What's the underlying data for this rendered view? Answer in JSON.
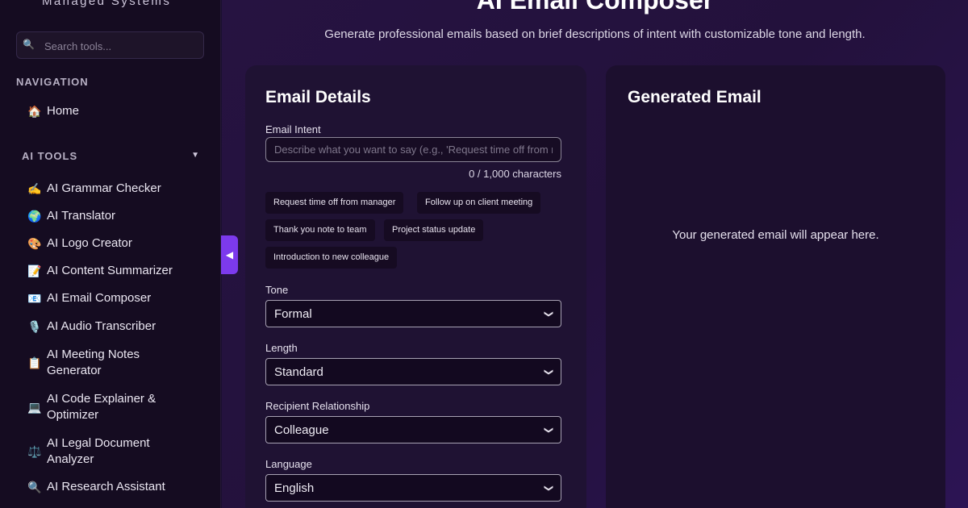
{
  "sidebar": {
    "brand": "Managed Systems",
    "search_placeholder": "Search tools...",
    "navigation_label": "NAVIGATION",
    "home": {
      "icon": "🏠",
      "label": "Home"
    },
    "ai_tools_label": "AI TOOLS",
    "ai_tools_caret": "▼",
    "tools": [
      {
        "icon": "✍️",
        "label": "AI Grammar Checker"
      },
      {
        "icon": "🌍",
        "label": "AI Translator"
      },
      {
        "icon": "🎨",
        "label": "AI Logo Creator"
      },
      {
        "icon": "📝",
        "label": "AI Content Summarizer"
      },
      {
        "icon": "📧",
        "label": "AI Email Composer"
      },
      {
        "icon": "🎙️",
        "label": "AI Audio Transcriber"
      },
      {
        "icon": "📋",
        "label": "AI Meeting Notes Generator"
      },
      {
        "icon": "💻",
        "label": "AI Code Explainer & Optimizer"
      },
      {
        "icon": "⚖️",
        "label": "AI Legal Document Analyzer"
      },
      {
        "icon": "🔍",
        "label": "AI Research Assistant"
      }
    ]
  },
  "collapse_icon": "◀",
  "header": {
    "title": "AI Email Composer",
    "subtitle": "Generate professional emails based on brief descriptions of intent with customizable tone and length."
  },
  "form": {
    "title": "Email Details",
    "intent_label": "Email Intent",
    "intent_placeholder": "Describe what you want to say (e.g., 'Request time off from manager')",
    "char_count": "0 / 1,000 characters",
    "chips": [
      "Request time off from manager",
      "Follow up on client meeting",
      "Thank you note to team",
      "Project status update",
      "Introduction to new colleague"
    ],
    "tone_label": "Tone",
    "tone_value": "Formal",
    "length_label": "Length",
    "length_value": "Standard",
    "recipient_label": "Recipient Relationship",
    "recipient_value": "Colleague",
    "language_label": "Language",
    "language_value": "English",
    "select_chevron": "⌄"
  },
  "output": {
    "title": "Generated Email",
    "placeholder": "Your generated email will appear here."
  }
}
